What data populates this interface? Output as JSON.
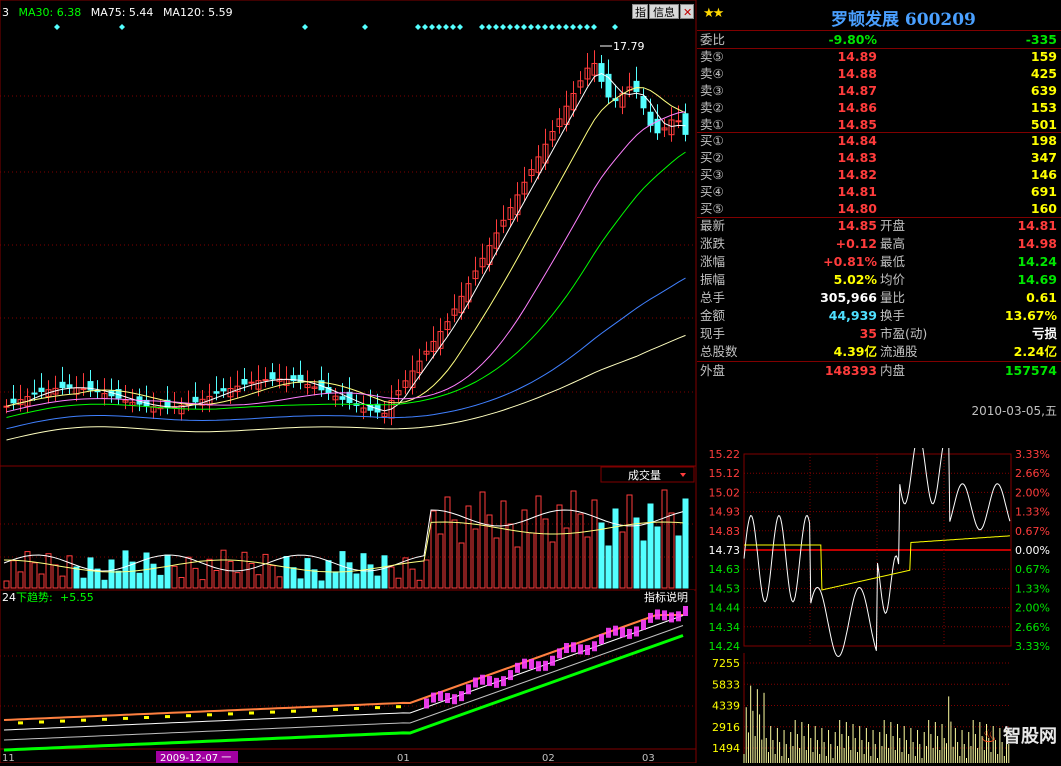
{
  "kline": {
    "ma_legend": [
      {
        "text": "3",
        "color": "#ffffff"
      },
      {
        "text": "MA30: 6.38",
        "color": "#00ff00"
      },
      {
        "text": "MA75: 5.44",
        "color": "#ffffff"
      },
      {
        "text": "MA120: 5.59",
        "color": "#ffffff"
      }
    ],
    "peak_label": "17.79",
    "volume_label": "成交量",
    "indicator_left": "24",
    "indicator_trend": "下趋势:",
    "indicator_value": "+5.55",
    "indicator_help": "指标说明",
    "date_axis": [
      "11",
      "2009-12-07 一",
      "01",
      "02",
      "03"
    ]
  },
  "toolbar": {
    "zhi": "指",
    "info": "信息"
  },
  "quote": {
    "stars": "★★",
    "title": "罗顿发展 600209",
    "weibi_label": "委比",
    "weibi_pct": "-9.80%",
    "weibi_diff": "-335",
    "sells": [
      {
        "label": "卖⑤",
        "price": "14.89",
        "vol": "159"
      },
      {
        "label": "卖④",
        "price": "14.88",
        "vol": "425"
      },
      {
        "label": "卖③",
        "price": "14.87",
        "vol": "639"
      },
      {
        "label": "卖②",
        "price": "14.86",
        "vol": "153"
      },
      {
        "label": "卖①",
        "price": "14.85",
        "vol": "501"
      }
    ],
    "buys": [
      {
        "label": "买①",
        "price": "14.84",
        "vol": "198"
      },
      {
        "label": "买②",
        "price": "14.83",
        "vol": "347"
      },
      {
        "label": "买③",
        "price": "14.82",
        "vol": "146"
      },
      {
        "label": "买④",
        "price": "14.81",
        "vol": "691"
      },
      {
        "label": "买⑤",
        "price": "14.80",
        "vol": "160"
      }
    ],
    "fields": [
      {
        "l1": "最新",
        "v1": "14.85",
        "c1": "red",
        "l2": "开盘",
        "v2": "14.81",
        "c2": "red"
      },
      {
        "l1": "涨跌",
        "v1": "+0.12",
        "c1": "red",
        "l2": "最高",
        "v2": "14.98",
        "c2": "red"
      },
      {
        "l1": "涨幅",
        "v1": "+0.81%",
        "c1": "red",
        "l2": "最低",
        "v2": "14.24",
        "c2": "green"
      },
      {
        "l1": "振幅",
        "v1": "5.02%",
        "c1": "yel",
        "l2": "均价",
        "v2": "14.69",
        "c2": "green"
      },
      {
        "l1": "总手",
        "v1": "305,966",
        "c1": "wht",
        "l2": "量比",
        "v2": "0.61",
        "c2": "yel"
      },
      {
        "l1": "金额",
        "v1": "44,939",
        "c1": "cyan",
        "l2": "换手",
        "v2": "13.67%",
        "c2": "yel"
      },
      {
        "l1": "现手",
        "v1": "35",
        "c1": "red",
        "l2": "市盈(动)",
        "v2": "亏损",
        "c2": "wht"
      },
      {
        "l1": "总股数",
        "v1": "4.39亿",
        "c1": "yel",
        "l2": "流通股",
        "v2": "2.24亿",
        "c2": "yel"
      },
      {
        "l1": "外盘",
        "v1": "148393",
        "c1": "red",
        "l2": "内盘",
        "v2": "157574",
        "c2": "green"
      }
    ],
    "date": "2010-03-05,五"
  },
  "intraday": {
    "price_ticks": [
      "15.22",
      "15.12",
      "15.02",
      "14.93",
      "14.83",
      "14.73",
      "14.63",
      "14.53",
      "14.44",
      "14.34",
      "14.24"
    ],
    "pct_ticks": [
      "3.33%",
      "2.66%",
      "2.00%",
      "1.33%",
      "0.67%",
      "0.00%",
      "0.67%",
      "1.33%",
      "2.00%",
      "2.66%",
      "3.33%"
    ],
    "vol_ticks": [
      "7255",
      "5833",
      "4339",
      "2916",
      "1494"
    ]
  },
  "watermark": "智股网",
  "colors": {
    "up": "#ff3c3c",
    "down": "#54ffff",
    "grid": "#800000"
  }
}
